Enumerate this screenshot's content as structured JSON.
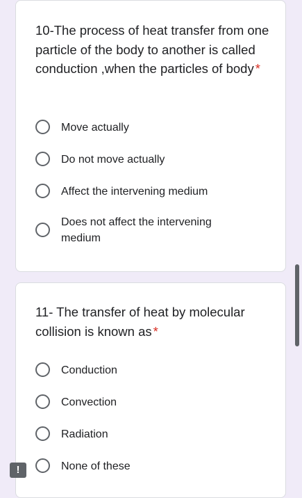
{
  "questions": [
    {
      "title": "10-The process of heat transfer from one particle of the body to another is called conduction ,when the particles of body",
      "required_mark": "*",
      "options": [
        {
          "label": "Move actually"
        },
        {
          "label": "Do not move actually"
        },
        {
          "label": "Affect the intervening medium"
        },
        {
          "label": "Does not affect the intervening medium"
        }
      ]
    },
    {
      "title": "11- The transfer of heat by molecular collision is known as",
      "required_mark": "*",
      "options": [
        {
          "label": "Conduction"
        },
        {
          "label": "Convection"
        },
        {
          "label": "Radiation"
        },
        {
          "label": "None of these"
        }
      ]
    }
  ],
  "feedback_button": {
    "icon": "report-problem-icon",
    "glyph": "!"
  },
  "colors": {
    "background": "#f0ebf8",
    "card": "#ffffff",
    "required": "#d93025",
    "radio_border": "#5f6368",
    "text": "#202124"
  }
}
